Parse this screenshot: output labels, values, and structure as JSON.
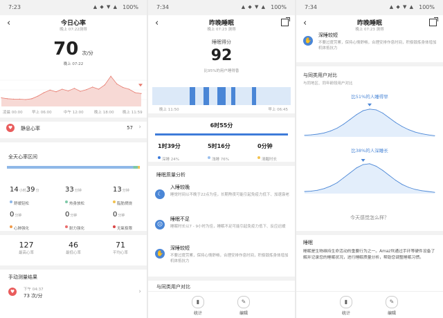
{
  "status_bar": {
    "time_1": "7:23",
    "time_2": "7:34",
    "time_3": "7:34",
    "battery": "100%",
    "signal_icons": "▲ ◆ ▼ ▲"
  },
  "panel1": {
    "title": "今日心率",
    "subtitle": "晚上 07:22测得",
    "current_value": "70",
    "current_unit": "次/分",
    "current_time": "晚上 07:22",
    "x_labels": [
      "凌晨 00:00",
      "早上 06:00",
      "中午 12:00",
      "晚上 18:00",
      "晚上 11:59"
    ],
    "resting": {
      "label": "静息心率",
      "value": "57"
    },
    "zone_title": "全天心率区间",
    "zones": [
      {
        "h": "14",
        "m": "39",
        "unit_h": "小时",
        "unit_m": "分",
        "label": "舒缓轻松",
        "color": "#8fb8e8"
      },
      {
        "v": "33",
        "unit": "分钟",
        "label": "热身放松",
        "color": "#7ec9a8"
      },
      {
        "v": "13",
        "unit": "分钟",
        "label": "脂肪燃烧",
        "color": "#f2c24f"
      },
      {
        "v": "0",
        "unit": "分钟",
        "label": "心肺强化",
        "color": "#f09a4a"
      },
      {
        "v": "0",
        "unit": "分钟",
        "label": "耐力强化",
        "color": "#ea6d6d"
      },
      {
        "v": "0",
        "unit": "分钟",
        "label": "无氧极限",
        "color": "#d94848"
      }
    ],
    "stats": [
      {
        "value": "127",
        "label": "最高心率"
      },
      {
        "value": "46",
        "label": "最低心率"
      },
      {
        "value": "71",
        "label": "平均心率"
      }
    ],
    "manual_title": "手动测量结果",
    "manual_time": "下午 04:37",
    "manual_value": "73 次/分"
  },
  "panel2": {
    "title": "昨晚睡眠",
    "subtitle": "晚上 07:23 测得",
    "score_label": "睡眠得分",
    "score": "92",
    "beat_text": "比95%的用户睡得香",
    "sleep_start": "晚上 11:50",
    "sleep_end": "早上 06:45",
    "total": "6时55分",
    "stages": [
      {
        "value": "1时39分",
        "label": "深睡 24%",
        "color": "#3d7bd9"
      },
      {
        "value": "5时16分",
        "label": "浅睡 76%",
        "color": "#9cc0ee"
      },
      {
        "value": "0分钟",
        "label": "清醒时长",
        "color": "#f2c24f"
      }
    ],
    "analysis_title": "睡眠质量分析",
    "analysis": [
      {
        "icon": "moon-icon",
        "title": "入睡较晚",
        "text": "睡觉时间以不晚于22点为佳，长期熬夜可能引起免疫力低下、加速衰老"
      },
      {
        "icon": "sad-face-icon",
        "title": "睡眠不足",
        "text": "睡眠时长以7 - 9小时为佳，睡眠不足可能引起免疫力低下、反应迟缓"
      },
      {
        "icon": "hand-icon",
        "title": "深睡较短",
        "text": "不要过度劳累，保持心情舒畅，合理安排作息时间，积极锻炼身体增加机体抵抗力"
      }
    ],
    "bottom_section_title": "与同类用户对比",
    "btn_stats": "统计",
    "btn_edit": "编辑"
  },
  "panel3": {
    "title": "昨晚睡眠",
    "subtitle": "晚上 07:23 测得",
    "top_item": {
      "title": "深睡较短",
      "text": "不要过度劳累，保持心情舒畅，合理安排作息时间，积极锻炼身体增加机体抵抗力"
    },
    "compare_title": "与同类用户对比",
    "compare_sub": "与同地区、同年龄段用户对比",
    "curve1_label": "比51%的人睡得早",
    "curve2_label": "比38%的人深睡长",
    "feeling": "今天感觉怎么样？",
    "sleep_title": "睡眠",
    "sleep_text": "睡眠是生物维持生命活动的重要行为之一。Amazfit通过手环等硬件设备了解并记录您的睡眠状况，进行睡眠质量分析，帮助您调整睡眠习惯。",
    "btn_stats": "统计",
    "btn_edit": "编辑"
  },
  "chart_data": [
    {
      "type": "line",
      "x": [
        0,
        1,
        2,
        3,
        4,
        5,
        6,
        7,
        8,
        9,
        10,
        11,
        12,
        13,
        14,
        15,
        16,
        17,
        18,
        19,
        20,
        21,
        22,
        23
      ],
      "values": [
        60,
        58,
        57,
        57,
        56,
        58,
        64,
        72,
        78,
        74,
        80,
        76,
        82,
        75,
        79,
        85,
        80,
        90,
        110,
        92,
        84,
        80,
        72,
        70
      ],
      "xlabel": "",
      "ylabel": "",
      "x_tick_labels": [
        "凌晨 00:00",
        "早上 06:00",
        "中午 12:00",
        "晚上 18:00",
        "晚上 11:59"
      ],
      "color": "#e77b6f"
    },
    {
      "type": "bar",
      "categories": [
        "舒缓轻松",
        "热身放松",
        "脂肪燃烧",
        "心肺强化",
        "耐力强化",
        "无氧极限"
      ],
      "values": [
        879,
        33,
        13,
        0,
        0,
        0
      ]
    },
    {
      "type": "bar",
      "series": [
        {
          "name": "深睡",
          "x": [
            0.27,
            0.37,
            0.47,
            0.57,
            0.72
          ],
          "width": [
            0.04,
            0.04,
            0.06,
            0.03,
            0.03
          ]
        }
      ]
    },
    {
      "type": "area",
      "title": "比51%的人睡得早",
      "x": [
        0,
        1,
        2,
        3,
        4,
        5,
        6,
        7,
        8,
        9,
        10,
        11,
        12,
        13,
        14,
        15,
        16,
        17,
        18,
        19,
        20
      ],
      "values": [
        4,
        5,
        7,
        10,
        15,
        22,
        32,
        44,
        56,
        66,
        70,
        68,
        60,
        48,
        36,
        26,
        18,
        12,
        8,
        5,
        3
      ],
      "marker_index": 10
    },
    {
      "type": "area",
      "title": "比38%的人深睡长",
      "x": [
        0,
        1,
        2,
        3,
        4,
        5,
        6,
        7,
        8,
        9,
        10,
        11,
        12,
        13,
        14,
        15,
        16,
        17,
        18,
        19,
        20
      ],
      "values": [
        5,
        6,
        8,
        12,
        18,
        26,
        38,
        50,
        62,
        70,
        72,
        66,
        56,
        44,
        32,
        22,
        15,
        10,
        7,
        5,
        3
      ],
      "marker_index": 9
    }
  ]
}
